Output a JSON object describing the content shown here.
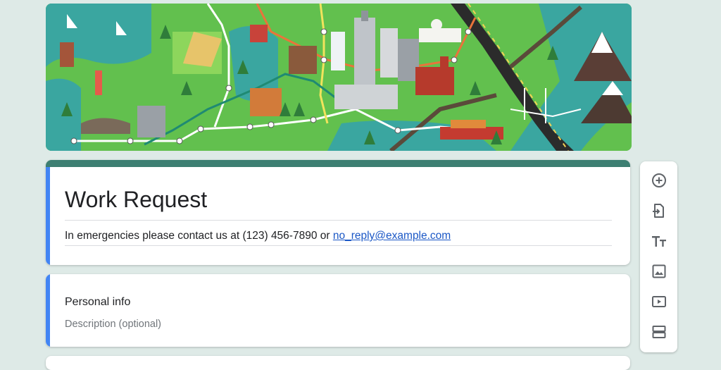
{
  "form": {
    "title": "Work Request",
    "description_text": "In emergencies please contact us at (123) 456-7890 or ",
    "description_link": "no_reply@example.com"
  },
  "section": {
    "title": "Personal info",
    "description_placeholder": "Description (optional)"
  },
  "toolbar": {
    "buttons": [
      {
        "icon": "add-circle-icon",
        "action": "Add question"
      },
      {
        "icon": "import-icon",
        "action": "Import questions"
      },
      {
        "icon": "title-text-icon",
        "action": "Add title and description"
      },
      {
        "icon": "image-icon",
        "action": "Add image"
      },
      {
        "icon": "video-icon",
        "action": "Add video"
      },
      {
        "icon": "section-icon",
        "action": "Add section"
      }
    ]
  },
  "colors": {
    "page_background": "#deeae7",
    "theme_bar": "#3d7f72",
    "accent": "#4285f4",
    "link": "#1a57c6",
    "banner_ground": "#62c04e"
  }
}
